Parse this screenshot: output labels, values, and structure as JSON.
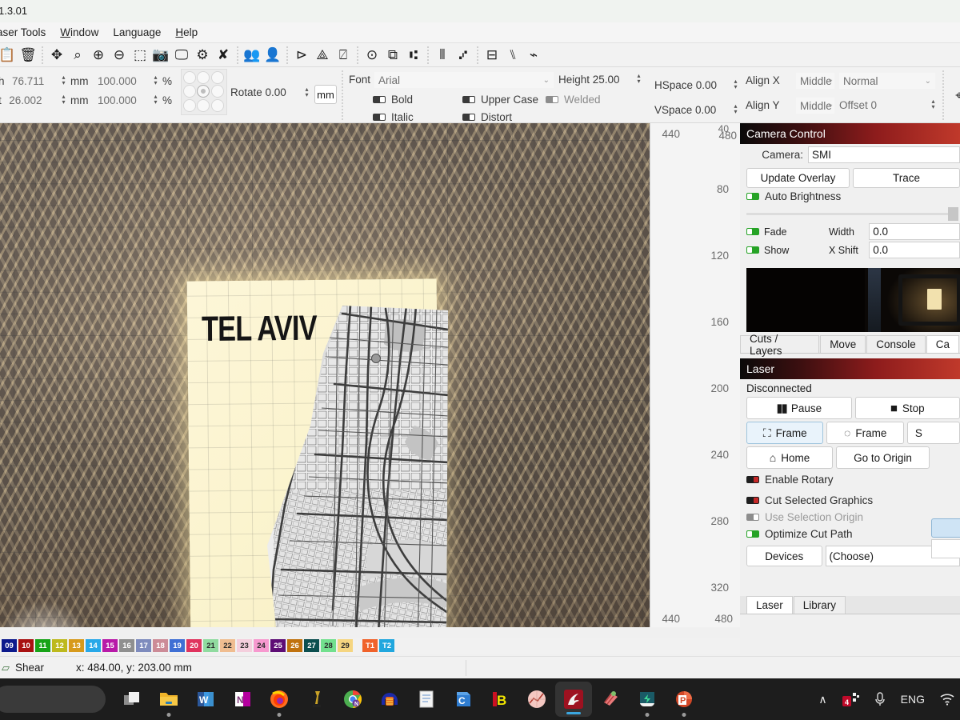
{
  "titlebar": {
    "text": "1.3.01"
  },
  "menu": {
    "items": [
      "aser Tools",
      "Window",
      "Language",
      "Help"
    ]
  },
  "icon_toolbar": {
    "groups": [
      [
        "paste-icon",
        "trash-icon"
      ],
      [
        "move-icon",
        "zoom-fit-icon",
        "zoom-in-icon",
        "zoom-out-icon",
        "marquee-select-icon",
        "camera-icon",
        "monitor-icon"
      ],
      [
        "settings-icon",
        "tools-icon"
      ],
      [
        "group-icon",
        "ungroup-icon"
      ],
      [
        "flip-horizontal-icon",
        "mirror-icon",
        "rotate-icon"
      ],
      [
        "align-center-icon",
        "align-objects-icon",
        "distribute-icon"
      ],
      [
        "weld-icon",
        "boolean-icon"
      ],
      [
        "array-icon",
        "offset-icon",
        "node-edit-icon"
      ]
    ]
  },
  "properties": {
    "width_label": "h",
    "width_value": "76.711",
    "height_label": "t",
    "height_value": "26.002",
    "unit": "mm",
    "scale_x": "100.000",
    "scale_y": "100.000",
    "percent": "%",
    "rotate_label": "Rotate 0.00",
    "unit_button": "mm",
    "font_label": "Font",
    "font_value": "Arial",
    "height_field_label": "Height 25.00",
    "hspace_label": "HSpace 0.00",
    "vspace_label": "VSpace 0.00",
    "align_x_label": "Align X",
    "align_x_value": "Middle",
    "align_y_label": "Align Y",
    "align_y_value": "Middle",
    "text_shape_value": "Normal",
    "offset_label": "Offset 0",
    "toggles": [
      {
        "name": "bold",
        "label": "Bold",
        "state": "off"
      },
      {
        "name": "italic",
        "label": "Italic",
        "state": "off"
      },
      {
        "name": "upper-case",
        "label": "Upper Case",
        "state": "off"
      },
      {
        "name": "distort",
        "label": "Distort",
        "state": "off"
      },
      {
        "name": "welded",
        "label": "Welded",
        "state": "off"
      }
    ]
  },
  "canvas": {
    "artwork_title": "TEL AVIV",
    "ruler_left_ticks": [
      "440",
      "440"
    ],
    "ruler_right_ticks": [
      "480",
      "40",
      "80",
      "120",
      "160",
      "200",
      "240",
      "280",
      "320",
      "480",
      "440"
    ]
  },
  "camera_panel": {
    "title": "Camera Control",
    "camera_label": "Camera:",
    "camera_value": "SMI",
    "update_overlay_button": "Update Overlay",
    "trace_button": "Trace",
    "auto_brightness_label": "Auto Brightness",
    "auto_brightness_state": "on",
    "fade_label": "Fade",
    "fade_state": "on",
    "show_label": "Show",
    "show_state": "on",
    "width_label": "Width",
    "width_value": "0.0",
    "x_shift_label": "X Shift",
    "x_shift_value": "0.0"
  },
  "dock_tabs": {
    "items": [
      "Cuts / Layers",
      "Move",
      "Console",
      "Ca"
    ],
    "active": "Ca"
  },
  "laser_panel": {
    "title": "Laser",
    "status": "Disconnected",
    "pause_button": "Pause",
    "stop_button": "Stop",
    "frame_button": "Frame",
    "frame_round_button": "Frame",
    "save_button": "S",
    "home_button": "Home",
    "go_to_origin_button": "Go to Origin",
    "enable_rotary_label": "Enable Rotary",
    "enable_rotary_state": "red",
    "cut_selected_label": "Cut Selected Graphics",
    "cut_selected_state": "red",
    "use_selection_origin_label": "Use Selection Origin",
    "use_selection_origin_state": "off",
    "optimize_cut_path_label": "Optimize Cut Path",
    "optimize_cut_path_state": "on",
    "devices_button": "Devices",
    "device_value": "(Choose)"
  },
  "bottom_tabs": {
    "items": [
      "Laser",
      "Library"
    ],
    "active": "Laser"
  },
  "palette": {
    "swatches": [
      {
        "label": "09",
        "color": "#0d1a8c"
      },
      {
        "label": "10",
        "color": "#a81111"
      },
      {
        "label": "11",
        "color": "#18a318"
      },
      {
        "label": "12",
        "color": "#bdb91d"
      },
      {
        "label": "13",
        "color": "#d79a1c"
      },
      {
        "label": "14",
        "color": "#28a8e8"
      },
      {
        "label": "15",
        "color": "#b81aa8"
      },
      {
        "label": "16",
        "color": "#8f8f8f"
      },
      {
        "label": "17",
        "color": "#7e8bbd"
      },
      {
        "label": "18",
        "color": "#cc8b97"
      },
      {
        "label": "19",
        "color": "#3f6fd4"
      },
      {
        "label": "20",
        "color": "#e0335e"
      },
      {
        "label": "21",
        "color": "#90dba0"
      },
      {
        "label": "22",
        "color": "#f0bd90"
      },
      {
        "label": "23",
        "color": "#f4cfdd"
      },
      {
        "label": "24",
        "color": "#f799cf"
      },
      {
        "label": "25",
        "color": "#5e0d75"
      },
      {
        "label": "26",
        "color": "#c0720e"
      },
      {
        "label": "27",
        "color": "#0c4f4f"
      },
      {
        "label": "28",
        "color": "#72e08e"
      },
      {
        "label": "29",
        "color": "#f5d580"
      }
    ],
    "tool_swatches": [
      {
        "label": "T1",
        "color": "#f0622a"
      },
      {
        "label": "T2",
        "color": "#21a7de"
      }
    ]
  },
  "statusbar": {
    "shear_label": "Shear",
    "coords": "x: 484.00, y: 203.00 mm"
  },
  "taskbar": {
    "items": [
      {
        "name": "task-view",
        "label": "",
        "running": false
      },
      {
        "name": "file-explorer",
        "label": "",
        "running": true
      },
      {
        "name": "word",
        "label": "W",
        "running": false
      },
      {
        "name": "onenote",
        "label": "N",
        "running": false
      },
      {
        "name": "firefox",
        "label": "",
        "running": true
      },
      {
        "name": "blender-ish",
        "label": "",
        "running": false
      },
      {
        "name": "chrome",
        "label": "",
        "running": false
      },
      {
        "name": "headphones-app",
        "label": "",
        "running": false
      },
      {
        "name": "notepad",
        "label": "",
        "running": false
      },
      {
        "name": "calibre",
        "label": "C",
        "running": false
      },
      {
        "name": "lightburn-b",
        "label": "B",
        "running": false
      },
      {
        "name": "graph-app",
        "label": "",
        "running": false
      },
      {
        "name": "lightburn",
        "label": "",
        "running": true
      },
      {
        "name": "shape-app",
        "label": "",
        "running": false
      },
      {
        "name": "wondershare",
        "label": "",
        "running": true
      },
      {
        "name": "powerpoint",
        "label": "P",
        "running": true
      }
    ],
    "tray": {
      "chevron": "∧",
      "badge_count": "4",
      "mic": "mic-icon",
      "language": "ENG",
      "wifi": "wifi-icon"
    }
  }
}
